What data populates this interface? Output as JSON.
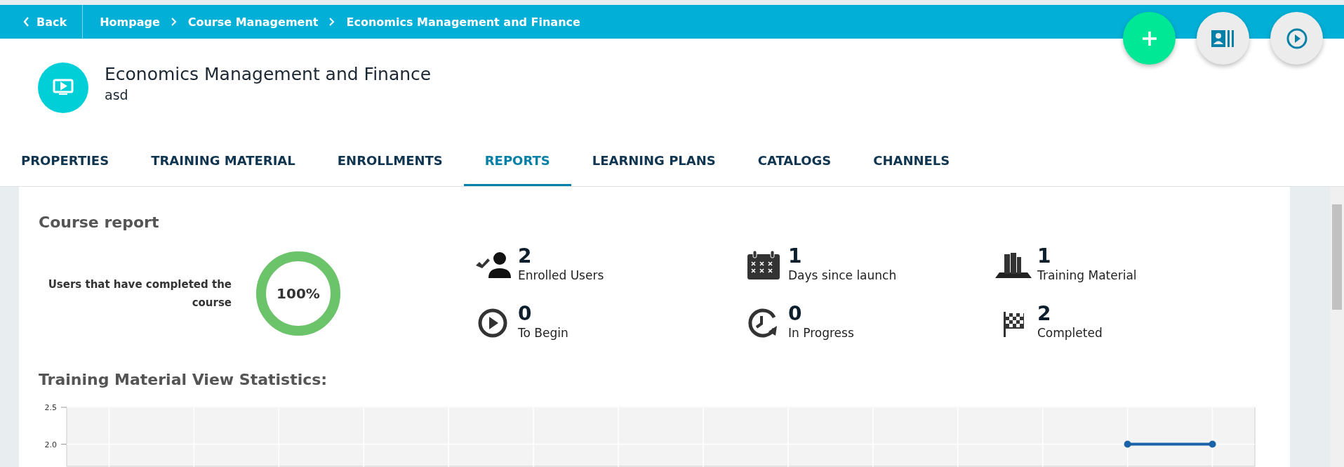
{
  "topbar": {
    "back": "Back",
    "breadcrumb": [
      "Hompage",
      "Course Management",
      "Economics Management and Finance"
    ]
  },
  "actions": [
    {
      "kind": "add"
    },
    {
      "kind": "profile"
    },
    {
      "kind": "play"
    }
  ],
  "course": {
    "title": "Economics Management and Finance",
    "subtitle": "asd"
  },
  "tabs": [
    {
      "label": "PROPERTIES",
      "selected": false
    },
    {
      "label": "TRAINING MATERIAL",
      "selected": false
    },
    {
      "label": "ENROLLMENTS",
      "selected": false
    },
    {
      "label": "REPORTS",
      "selected": true
    },
    {
      "label": "LEARNING PLANS",
      "selected": false
    },
    {
      "label": "CATALOGS",
      "selected": false
    },
    {
      "label": "CHANNELS",
      "selected": false
    }
  ],
  "report": {
    "title": "Course report",
    "completion": {
      "label": "Users that have completed the course",
      "value": "100%",
      "level": 1
    },
    "stats": [
      {
        "kind": "enrolled",
        "value": "2",
        "label": "Enrolled Users"
      },
      {
        "kind": "days",
        "value": "1",
        "label": "Days since launch"
      },
      {
        "kind": "material",
        "value": "1",
        "label": "Training Material"
      },
      {
        "kind": "begin",
        "value": "0",
        "label": "To Begin"
      },
      {
        "kind": "progress",
        "value": "0",
        "label": "In Progress"
      },
      {
        "kind": "completed",
        "value": "2",
        "label": "Completed"
      }
    ]
  },
  "statistics": {
    "title": "Training Material View Statistics:",
    "chart_data": {
      "type": "line",
      "ylim": [
        1.7,
        2.5
      ],
      "yticks": [
        2.5,
        {
          "value": 2,
          "label": "2.0"
        }
      ],
      "grid": true,
      "categories": [
        null,
        null,
        null,
        null,
        null,
        null,
        null,
        null,
        null,
        null,
        null,
        null,
        null,
        null
      ],
      "series": [
        {
          "color": "#1a62a8",
          "marker": "circle",
          "values": [
            null,
            null,
            null,
            null,
            null,
            null,
            null,
            null,
            null,
            null,
            null,
            null,
            2,
            2
          ]
        }
      ]
    }
  }
}
